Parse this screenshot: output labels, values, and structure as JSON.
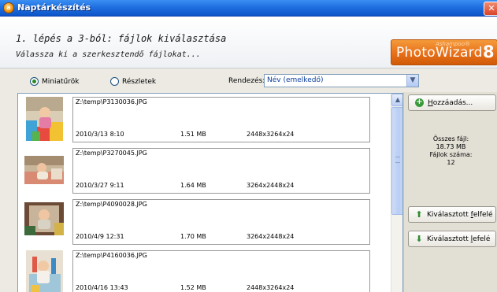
{
  "window": {
    "title": "Naptárkészítés",
    "close_glyph": "✕"
  },
  "header": {
    "step_title": "1. lépés a 3-ból: fájlok kiválasztása",
    "step_subtitle": "Válassza ki a szerkesztendő fájlokat...",
    "logo_brand": "Ashampoo®",
    "logo_name": "PhotoWizard",
    "logo_version": "8"
  },
  "view_options": {
    "thumbnails_label": "Miniatűrök",
    "details_label": "Részletek",
    "selected": "thumbnails"
  },
  "sort": {
    "label": "Rendezés:",
    "value": "Név (emelkedő)"
  },
  "files": [
    {
      "path": "Z:\\temp\\P3130036.JPG",
      "date": "2010/3/13 8:10",
      "size": "1.51 MB",
      "dimensions": "2448x3264x24",
      "orientation": "portrait"
    },
    {
      "path": "Z:\\temp\\P3270045.JPG",
      "date": "2010/3/27 9:11",
      "size": "1.64 MB",
      "dimensions": "3264x2448x24",
      "orientation": "landscape"
    },
    {
      "path": "Z:\\temp\\P4090028.JPG",
      "date": "2010/4/9 12:31",
      "size": "1.70 MB",
      "dimensions": "3264x2448x24",
      "orientation": "landscape"
    },
    {
      "path": "Z:\\temp\\P4160036.JPG",
      "date": "2010/4/16 13:43",
      "size": "1.52 MB",
      "dimensions": "2448x3264x24",
      "orientation": "portrait"
    }
  ],
  "actions": {
    "add": {
      "prefix": "",
      "underlined": "H",
      "rest": "ozzáadás...",
      "icon": "plus-circle-icon"
    },
    "move_up": {
      "prefix": "Kiválasztott ",
      "underlined": "f",
      "rest": "elfelé",
      "icon": "arrow-up-icon"
    },
    "move_down": {
      "prefix": "Kiválasztott ",
      "underlined": "l",
      "rest": "efelé",
      "icon": "arrow-down-icon"
    }
  },
  "stats": {
    "total_size_label": "Összes fájl:",
    "total_size_value": "18.73 MB",
    "file_count_label": "Fájlok száma:",
    "file_count_value": "12"
  },
  "colors": {
    "titlebar": "#1f6fe0",
    "logo_orange": "#e8701a",
    "list_border": "#7f9db9"
  }
}
